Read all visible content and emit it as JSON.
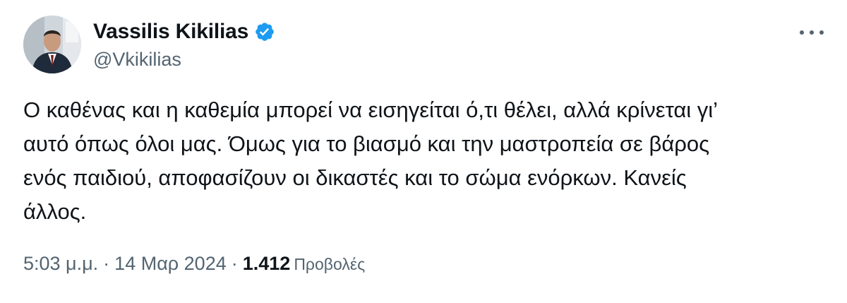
{
  "author": {
    "display_name": "Vassilis Kikilias",
    "handle": "@Vkikilias",
    "verified": true
  },
  "tweet": {
    "lines": [
      "Ο καθένας και η καθεμία μπορεί να εισηγείται ό,τι θέλει, αλλά κρίνεται γι’",
      "αυτό όπως όλοι μας. Όμως για το βιασμό και την μαστροπεία σε βάρος",
      "ενός παιδιού, αποφασίζουν οι δικαστές και το σώμα ενόρκων. Κανείς",
      "άλλος."
    ]
  },
  "meta": {
    "time": "5:03 μ.μ.",
    "separator": "·",
    "date": "14 Μαρ 2024",
    "views_count": "1.412",
    "views_label": "Προβολές"
  },
  "icons": {
    "verified": "verified-badge-icon",
    "more": "more-options-icon"
  },
  "colors": {
    "text": "#0f1419",
    "secondary": "#536471",
    "verified_blue": "#1d9bf0"
  }
}
